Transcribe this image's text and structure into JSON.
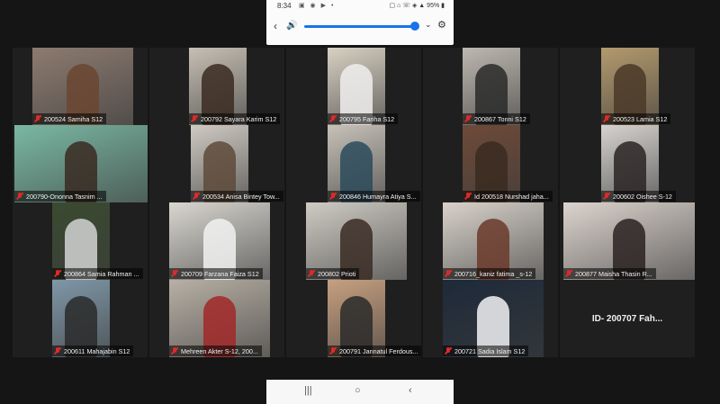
{
  "status_bar": {
    "time": "8:34",
    "icons": "▣ ◉ ▶ •",
    "right": "▢ ⌂ ☏ ◈ ▲ 95% ▮"
  },
  "volume_bar": {
    "back": "‹",
    "level_percent": 94,
    "expand": "⌄",
    "settings": "⚙"
  },
  "participants": [
    {
      "name": "200524 Samiha S12",
      "bg": "#8c7b70",
      "face": "#6a4630"
    },
    {
      "name": "200792 Sayara Karim S12",
      "bg": "#c6bfb4",
      "face": "#3a2a20"
    },
    {
      "name": "200795 Fariha S12",
      "bg": "#d8d1c3",
      "face": "#f0eeee"
    },
    {
      "name": "200867 Tonni S12",
      "bg": "#bdb8b0",
      "face": "#2a2a2a"
    },
    {
      "name": "200523 Lamia S12",
      "bg": "#b39a6e",
      "face": "#4a3828"
    },
    {
      "name": "200790-Ononna Tasnim ...",
      "bg": "#7ab8a4",
      "face": "#3a2a22"
    },
    {
      "name": "200534 Anisa Bintey Tow...",
      "bg": "#cfcac2",
      "face": "#5e4a3a"
    },
    {
      "name": "200846 Humayra Atiya S...",
      "bg": "#c7c1b8",
      "face": "#2c4a5c"
    },
    {
      "name": "Id 200518 Nurshad jaha...",
      "bg": "#6e4a38",
      "face": "#3a2a20"
    },
    {
      "name": "200602 Oishee S-12",
      "bg": "#d6d3cf",
      "face": "#2a2424"
    },
    {
      "name": "200864 Samia Rahman ...",
      "bg": "#3a4a30",
      "face": "#d4d4d4"
    },
    {
      "name": "200709 Farzana Faiza S12",
      "bg": "#d9d6d0",
      "face": "#f2f2f2"
    },
    {
      "name": "200802 Prioti",
      "bg": "#cfcbc4",
      "face": "#3a2c24"
    },
    {
      "name": "200716_kaniz fatima _s-12",
      "bg": "#d8d2ca",
      "face": "#6a3a2a"
    },
    {
      "name": "200877 Maisha Thasin R...",
      "bg": "#dcd4ce",
      "face": "#2a2222"
    },
    {
      "name": "200611 Mahajabin S12",
      "bg": "#7f97a8",
      "face": "#2a2a2a"
    },
    {
      "name": "Mehreen Akter S-12, 200...",
      "bg": "#b8b0a5",
      "face": "#a02828"
    },
    {
      "name": "200791 Jannatul Ferdous...",
      "bg": "#c7a080",
      "face": "#2a2a2a"
    },
    {
      "name": "200721 Sadia Islam S12",
      "bg": "#1e2a3a",
      "face": "#f2f2f4"
    },
    {
      "name": "ID- 200707 Fah..."
    }
  ],
  "nav_bar": {
    "recents": "|||",
    "home": "○",
    "back": "‹"
  }
}
